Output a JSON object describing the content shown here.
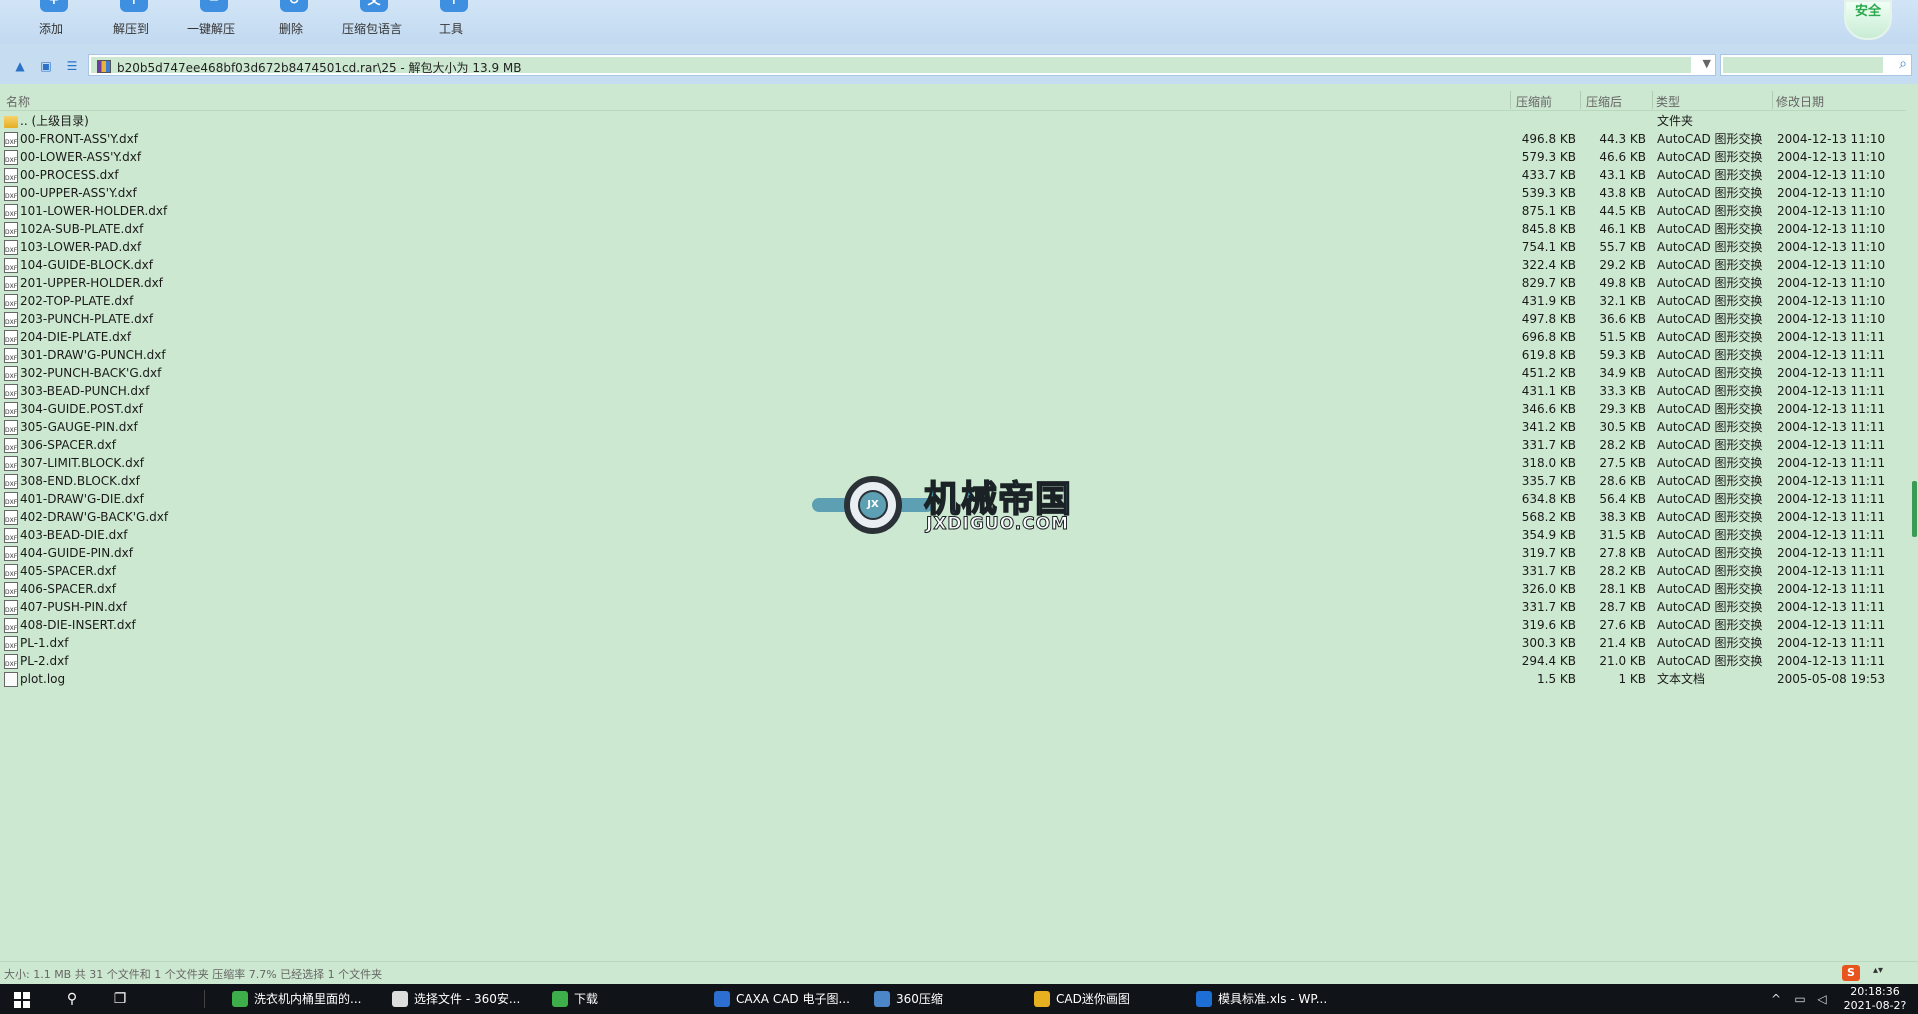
{
  "toolbar": {
    "buttons": [
      {
        "label": "添加",
        "glyph": "+"
      },
      {
        "label": "解压到",
        "glyph": "↑"
      },
      {
        "label": "一键解压",
        "glyph": "−"
      },
      {
        "label": "删除",
        "glyph": "↻"
      },
      {
        "label": "压缩包语言",
        "glyph": "文"
      },
      {
        "label": "工具",
        "glyph": "↑"
      }
    ],
    "shield_label": "安全"
  },
  "address": {
    "path_text": "b20b5d747ee468bf03d672b8474501cd.rar\\25 - 解包大小为 13.9 MB",
    "search_placeholder": ""
  },
  "columns": {
    "name": "名称",
    "packed": "压缩前",
    "compressed": "压缩后",
    "type": "类型",
    "modified": "修改日期"
  },
  "files": [
    {
      "name": ".. (上级目录)",
      "packed": "",
      "compressed": "",
      "type": "文件夹",
      "date": "",
      "icon": "folder-icon"
    },
    {
      "name": "00-FRONT-ASS'Y.dxf",
      "packed": "496.8 KB",
      "compressed": "44.3 KB",
      "type": "AutoCAD 图形交换",
      "date": "2004-12-13 11:10",
      "icon": "dxf-file-icon"
    },
    {
      "name": "00-LOWER-ASS'Y.dxf",
      "packed": "579.3 KB",
      "compressed": "46.6 KB",
      "type": "AutoCAD 图形交换",
      "date": "2004-12-13 11:10",
      "icon": "dxf-file-icon"
    },
    {
      "name": "00-PROCESS.dxf",
      "packed": "433.7 KB",
      "compressed": "43.1 KB",
      "type": "AutoCAD 图形交换",
      "date": "2004-12-13 11:10",
      "icon": "dxf-file-icon"
    },
    {
      "name": "00-UPPER-ASS'Y.dxf",
      "packed": "539.3 KB",
      "compressed": "43.8 KB",
      "type": "AutoCAD 图形交换",
      "date": "2004-12-13 11:10",
      "icon": "dxf-file-icon"
    },
    {
      "name": "101-LOWER-HOLDER.dxf",
      "packed": "875.1 KB",
      "compressed": "44.5 KB",
      "type": "AutoCAD 图形交换",
      "date": "2004-12-13 11:10",
      "icon": "dxf-file-icon"
    },
    {
      "name": "102A-SUB-PLATE.dxf",
      "packed": "845.8 KB",
      "compressed": "46.1 KB",
      "type": "AutoCAD 图形交换",
      "date": "2004-12-13 11:10",
      "icon": "dxf-file-icon"
    },
    {
      "name": "103-LOWER-PAD.dxf",
      "packed": "754.1 KB",
      "compressed": "55.7 KB",
      "type": "AutoCAD 图形交换",
      "date": "2004-12-13 11:10",
      "icon": "dxf-file-icon"
    },
    {
      "name": "104-GUIDE-BLOCK.dxf",
      "packed": "322.4 KB",
      "compressed": "29.2 KB",
      "type": "AutoCAD 图形交换",
      "date": "2004-12-13 11:10",
      "icon": "dxf-file-icon"
    },
    {
      "name": "201-UPPER-HOLDER.dxf",
      "packed": "829.7 KB",
      "compressed": "49.8 KB",
      "type": "AutoCAD 图形交换",
      "date": "2004-12-13 11:10",
      "icon": "dxf-file-icon"
    },
    {
      "name": "202-TOP-PLATE.dxf",
      "packed": "431.9 KB",
      "compressed": "32.1 KB",
      "type": "AutoCAD 图形交换",
      "date": "2004-12-13 11:10",
      "icon": "dxf-file-icon"
    },
    {
      "name": "203-PUNCH-PLATE.dxf",
      "packed": "497.8 KB",
      "compressed": "36.6 KB",
      "type": "AutoCAD 图形交换",
      "date": "2004-12-13 11:10",
      "icon": "dxf-file-icon"
    },
    {
      "name": "204-DIE-PLATE.dxf",
      "packed": "696.8 KB",
      "compressed": "51.5 KB",
      "type": "AutoCAD 图形交换",
      "date": "2004-12-13 11:11",
      "icon": "dxf-file-icon"
    },
    {
      "name": "301-DRAW'G-PUNCH.dxf",
      "packed": "619.8 KB",
      "compressed": "59.3 KB",
      "type": "AutoCAD 图形交换",
      "date": "2004-12-13 11:11",
      "icon": "dxf-file-icon"
    },
    {
      "name": "302-PUNCH-BACK'G.dxf",
      "packed": "451.2 KB",
      "compressed": "34.9 KB",
      "type": "AutoCAD 图形交换",
      "date": "2004-12-13 11:11",
      "icon": "dxf-file-icon"
    },
    {
      "name": "303-BEAD-PUNCH.dxf",
      "packed": "431.1 KB",
      "compressed": "33.3 KB",
      "type": "AutoCAD 图形交换",
      "date": "2004-12-13 11:11",
      "icon": "dxf-file-icon"
    },
    {
      "name": "304-GUIDE.POST.dxf",
      "packed": "346.6 KB",
      "compressed": "29.3 KB",
      "type": "AutoCAD 图形交换",
      "date": "2004-12-13 11:11",
      "icon": "dxf-file-icon"
    },
    {
      "name": "305-GAUGE-PIN.dxf",
      "packed": "341.2 KB",
      "compressed": "30.5 KB",
      "type": "AutoCAD 图形交换",
      "date": "2004-12-13 11:11",
      "icon": "dxf-file-icon"
    },
    {
      "name": "306-SPACER.dxf",
      "packed": "331.7 KB",
      "compressed": "28.2 KB",
      "type": "AutoCAD 图形交换",
      "date": "2004-12-13 11:11",
      "icon": "dxf-file-icon"
    },
    {
      "name": "307-LIMIT.BLOCK.dxf",
      "packed": "318.0 KB",
      "compressed": "27.5 KB",
      "type": "AutoCAD 图形交换",
      "date": "2004-12-13 11:11",
      "icon": "dxf-file-icon"
    },
    {
      "name": "308-END.BLOCK.dxf",
      "packed": "335.7 KB",
      "compressed": "28.6 KB",
      "type": "AutoCAD 图形交换",
      "date": "2004-12-13 11:11",
      "icon": "dxf-file-icon"
    },
    {
      "name": "401-DRAW'G-DIE.dxf",
      "packed": "634.8 KB",
      "compressed": "56.4 KB",
      "type": "AutoCAD 图形交换",
      "date": "2004-12-13 11:11",
      "icon": "dxf-file-icon"
    },
    {
      "name": "402-DRAW'G-BACK'G.dxf",
      "packed": "568.2 KB",
      "compressed": "38.3 KB",
      "type": "AutoCAD 图形交换",
      "date": "2004-12-13 11:11",
      "icon": "dxf-file-icon"
    },
    {
      "name": "403-BEAD-DIE.dxf",
      "packed": "354.9 KB",
      "compressed": "31.5 KB",
      "type": "AutoCAD 图形交换",
      "date": "2004-12-13 11:11",
      "icon": "dxf-file-icon"
    },
    {
      "name": "404-GUIDE-PIN.dxf",
      "packed": "319.7 KB",
      "compressed": "27.8 KB",
      "type": "AutoCAD 图形交换",
      "date": "2004-12-13 11:11",
      "icon": "dxf-file-icon"
    },
    {
      "name": "405-SPACER.dxf",
      "packed": "331.7 KB",
      "compressed": "28.2 KB",
      "type": "AutoCAD 图形交换",
      "date": "2004-12-13 11:11",
      "icon": "dxf-file-icon"
    },
    {
      "name": "406-SPACER.dxf",
      "packed": "326.0 KB",
      "compressed": "28.1 KB",
      "type": "AutoCAD 图形交换",
      "date": "2004-12-13 11:11",
      "icon": "dxf-file-icon"
    },
    {
      "name": "407-PUSH-PIN.dxf",
      "packed": "331.7 KB",
      "compressed": "28.7 KB",
      "type": "AutoCAD 图形交换",
      "date": "2004-12-13 11:11",
      "icon": "dxf-file-icon"
    },
    {
      "name": "408-DIE-INSERT.dxf",
      "packed": "319.6 KB",
      "compressed": "27.6 KB",
      "type": "AutoCAD 图形交换",
      "date": "2004-12-13 11:11",
      "icon": "dxf-file-icon"
    },
    {
      "name": "PL-1.dxf",
      "packed": "300.3 KB",
      "compressed": "21.4 KB",
      "type": "AutoCAD 图形交换",
      "date": "2004-12-13 11:11",
      "icon": "dxf-file-icon"
    },
    {
      "name": "PL-2.dxf",
      "packed": "294.4 KB",
      "compressed": "21.0 KB",
      "type": "AutoCAD 图形交换",
      "date": "2004-12-13 11:11",
      "icon": "dxf-file-icon"
    },
    {
      "name": "plot.log",
      "packed": "1.5 KB",
      "compressed": "1 KB",
      "type": "文本文档",
      "date": "2005-05-08 19:53",
      "icon": "text-file-icon"
    }
  ],
  "dxf_icon_text": "DXF",
  "watermark": {
    "cn": "机械帝国",
    "en": "JXDIGUO.COM",
    "badge": "JX",
    "colors": {
      "teal": "#3f8aa3",
      "dark": "#1b2226"
    }
  },
  "status": {
    "text": "大小: 1.1 MB 共 31 个文件和 1 个文件夹 压缩率 7.7% 已经选择 1 个文件夹",
    "ime_label": "S"
  },
  "taskbar": {
    "items": [
      {
        "label": "洗衣机内桶里面的...",
        "color": "#3dae4a"
      },
      {
        "label": "选择文件 - 360安...",
        "color": "#dddddd"
      },
      {
        "label": "下载",
        "color": "#3dae4a"
      },
      {
        "label": "CAXA CAD 电子图...",
        "color": "#2d6fd1"
      },
      {
        "label": "360压缩",
        "color": "#4a86c8"
      },
      {
        "label": "CAD迷你画图",
        "color": "#e6b020"
      },
      {
        "label": "模具标准.xls - WP...",
        "color": "#1d6fd6"
      }
    ],
    "clock_time": "20:18:36",
    "clock_date": "2021-08-2?"
  },
  "colors": {
    "background": "#cde8d0",
    "toolbar": "#c6dcf1",
    "accent": "#3f8fe0",
    "taskbar": "#101418"
  }
}
